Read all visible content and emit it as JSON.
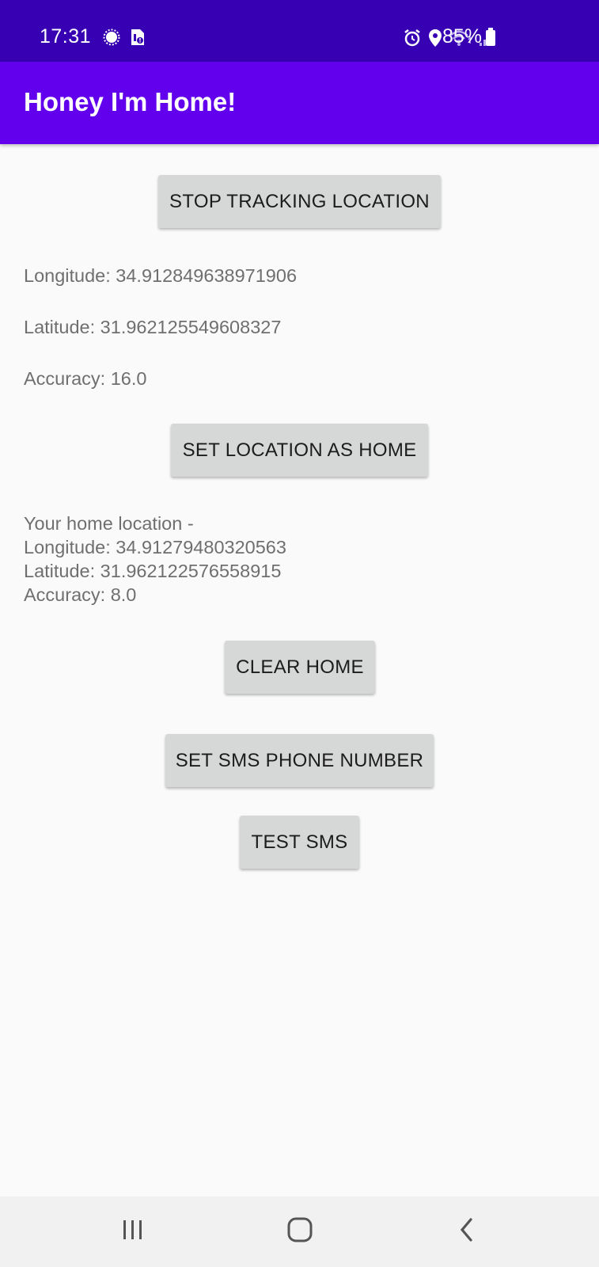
{
  "status_bar": {
    "time": "17:31",
    "battery_percent": "85%",
    "left_icons": [
      "settings-gear-icon",
      "sim-alert-icon"
    ],
    "right_icons": [
      "alarm-icon",
      "location-pin-icon",
      "wifi-icon",
      "signal-icon",
      "battery-icon"
    ]
  },
  "app_bar": {
    "title": "Honey I'm Home!",
    "color": "#6200ee"
  },
  "main": {
    "stop_tracking_label": "STOP TRACKING LOCATION",
    "longitude_text": "Longitude: 34.912849638971906",
    "latitude_text": "Latitude: 31.962125549608327",
    "accuracy_text": "Accuracy: 16.0",
    "set_home_label": "SET LOCATION AS HOME",
    "home_heading": "Your home location -",
    "home_longitude": "Longitude: 34.91279480320563",
    "home_latitude": "Latitude: 31.962122576558915",
    "home_accuracy": "Accuracy: 8.0",
    "clear_home_label": "CLEAR HOME",
    "set_sms_label": "SET SMS PHONE NUMBER",
    "test_sms_label": "TEST SMS"
  },
  "nav_bar": {
    "items": [
      "recent-apps-icon",
      "home-icon",
      "back-icon"
    ]
  }
}
